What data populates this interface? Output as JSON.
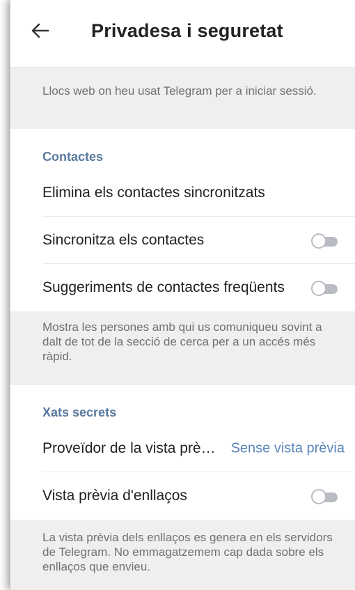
{
  "header": {
    "back_icon": "arrow-left-icon",
    "title": "Privadesa i seguretat"
  },
  "websites_info": "Llocs web on heu usat Telegram per a iniciar sessió.",
  "contacts": {
    "section_title": "Contactes",
    "delete_synced": "Elimina els contactes sincronitzats",
    "sync_contacts": {
      "label": "Sincronitza els contactes",
      "enabled": false
    },
    "suggest_frequent": {
      "label": "Suggeriments de contactes freqüents",
      "enabled": false
    },
    "info": "Mostra les persones amb qui us comuniqueu sovint a dalt de tot de la secció de cerca per a un accés més ràpid."
  },
  "secret_chats": {
    "section_title": "Xats secrets",
    "preview_provider": {
      "label": "Proveïdor de la vista prè…",
      "value": "Sense vista prèvia"
    },
    "link_previews": {
      "label": "Vista prèvia d'enllaços",
      "enabled": false
    },
    "info": "La vista prèvia dels enllaços es genera en els servidors de Telegram. No emmagatzemem cap dada sobre els enllaços que envieu."
  },
  "colors": {
    "accent": "#5a7a9f",
    "value_text": "#5a86b8",
    "info_background": "#efefef",
    "toggle_off": "#b8bcc2"
  }
}
